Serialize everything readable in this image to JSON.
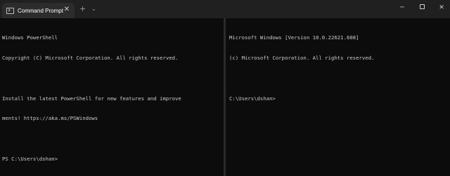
{
  "tab": {
    "title": "Command Prompt",
    "icon": "terminal-icon",
    "close_glyph": "✕"
  },
  "tabbar": {
    "new_tab_glyph": "+",
    "dropdown_glyph": "⌄"
  },
  "window_controls": {
    "minimize_glyph": "─",
    "close_glyph": "✕"
  },
  "left_pane": {
    "lines": [
      "Windows PowerShell",
      "Copyright (C) Microsoft Corporation. All rights reserved.",
      "",
      "Install the latest PowerShell for new features and improve",
      "ments! https://aka.ms/PSWindows",
      "",
      "PS C:\\Users\\dshan>"
    ]
  },
  "right_pane": {
    "lines": [
      "Microsoft Windows [Version 10.0.22621.608]",
      "(c) Microsoft Corporation. All rights reserved.",
      "",
      "C:\\Users\\dshan>"
    ]
  },
  "colors": {
    "background": "#0c0c0c",
    "titlebar": "#202020",
    "active_tab": "#2c2c2c",
    "text": "#cccccc"
  }
}
